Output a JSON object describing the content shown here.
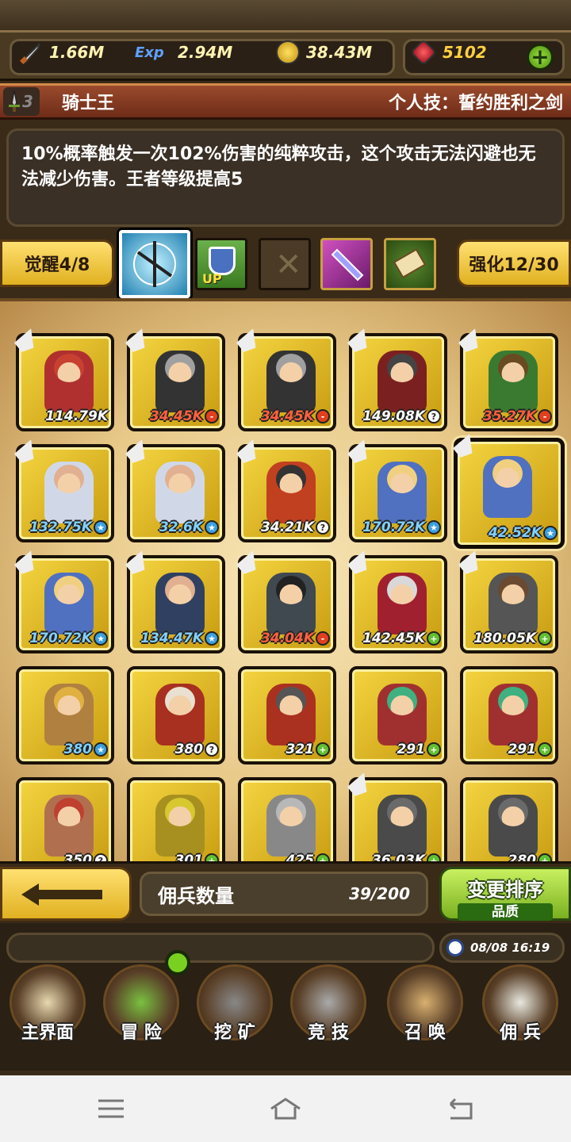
{
  "resources": {
    "attack": "1.66M",
    "exp": "2.94M",
    "gold": "38.43M",
    "gems": "5102",
    "exp_tag": "Exp"
  },
  "hero": {
    "rank": "3",
    "name": "骑士王",
    "skill_title": "个人技：誓约胜利之剑",
    "description": "10%概率触发一次102%伤害的纯粹攻击，这个攻击无法闪避也无法减少伤害。王者等级提高5"
  },
  "tabs": {
    "awaken": "觉醒4/8",
    "enhance": "强化12/30",
    "up_label": "UP"
  },
  "mercenaries": [
    {
      "power": "114.79K",
      "mark": "",
      "hair": "#c84030",
      "cloth": "#b03030"
    },
    {
      "power": "34.45K",
      "mark": "-",
      "hair": "#a0a0a0",
      "cloth": "#333333"
    },
    {
      "power": "34.45K",
      "mark": "-",
      "hair": "#a0a0a0",
      "cloth": "#333333"
    },
    {
      "power": "149.08K",
      "mark": "?",
      "hair": "#444444",
      "cloth": "#7a2020"
    },
    {
      "power": "35.27K",
      "mark": "-",
      "hair": "#6a4a20",
      "cloth": "#3a7a30"
    },
    {
      "power": "132.75K",
      "mark": "★",
      "hair": "#e0b090",
      "cloth": "#d0d8e8"
    },
    {
      "power": "32.6K",
      "mark": "★",
      "hair": "#e0b090",
      "cloth": "#d0d8e8"
    },
    {
      "power": "34.21K",
      "mark": "?",
      "hair": "#333333",
      "cloth": "#c04020"
    },
    {
      "power": "170.72K",
      "mark": "★",
      "hair": "#f0d080",
      "cloth": "#5070c0"
    },
    {
      "power": "42.52K",
      "mark": "★",
      "hair": "#f0d080",
      "cloth": "#5070c0"
    },
    {
      "power": "170.72K",
      "mark": "★",
      "hair": "#f0d080",
      "cloth": "#5070c0"
    },
    {
      "power": "134.47K",
      "mark": "★",
      "hair": "#e0b090",
      "cloth": "#304060"
    },
    {
      "power": "34.04K",
      "mark": "-",
      "hair": "#222222",
      "cloth": "#404850"
    },
    {
      "power": "142.45K",
      "mark": "+",
      "hair": "#d8d8d8",
      "cloth": "#a02030"
    },
    {
      "power": "180.05K",
      "mark": "+",
      "hair": "#6a4a30",
      "cloth": "#555555"
    },
    {
      "power": "380",
      "mark": "★",
      "hair": "#e0b040",
      "cloth": "#b08040"
    },
    {
      "power": "380",
      "mark": "?",
      "hair": "#e8e0d0",
      "cloth": "#a83020"
    },
    {
      "power": "321",
      "mark": "+",
      "hair": "#555555",
      "cloth": "#aa3020"
    },
    {
      "power": "291",
      "mark": "+",
      "hair": "#40b080",
      "cloth": "#a03030"
    },
    {
      "power": "291",
      "mark": "+",
      "hair": "#40b080",
      "cloth": "#a03030"
    },
    {
      "power": "350",
      "mark": "?",
      "hair": "#c04030",
      "cloth": "#b07050"
    },
    {
      "power": "301",
      "mark": "+",
      "hair": "#d8c830",
      "cloth": "#a89020"
    },
    {
      "power": "425",
      "mark": "+",
      "hair": "#b8b8b8",
      "cloth": "#888888"
    },
    {
      "power": "36.03K",
      "mark": "+",
      "hair": "#6a6a6a",
      "cloth": "#4a4a4a"
    },
    {
      "power": "280",
      "mark": "+",
      "hair": "#6a6a6a",
      "cloth": "#4a4a4a"
    }
  ],
  "bottom": {
    "count_label": "佣兵数量",
    "count_value": "39/200",
    "sort_label": "变更排序",
    "sort_sub": "品质"
  },
  "status": {
    "time": "08/08 16:19"
  },
  "nav": [
    {
      "label": "主界面",
      "icon": "map-scroll-icon"
    },
    {
      "label": "冒 险",
      "icon": "island-icon"
    },
    {
      "label": "挖 矿",
      "icon": "pickaxe-icon"
    },
    {
      "label": "竞 技",
      "icon": "crossed-swords-icon"
    },
    {
      "label": "召 唤",
      "icon": "scroll-icon"
    },
    {
      "label": "佣 兵",
      "icon": "tent-icon"
    }
  ],
  "colors": {
    "gold_button": "#f0c830",
    "green_button": "#9ad040",
    "card_gold": "#e8c020"
  }
}
